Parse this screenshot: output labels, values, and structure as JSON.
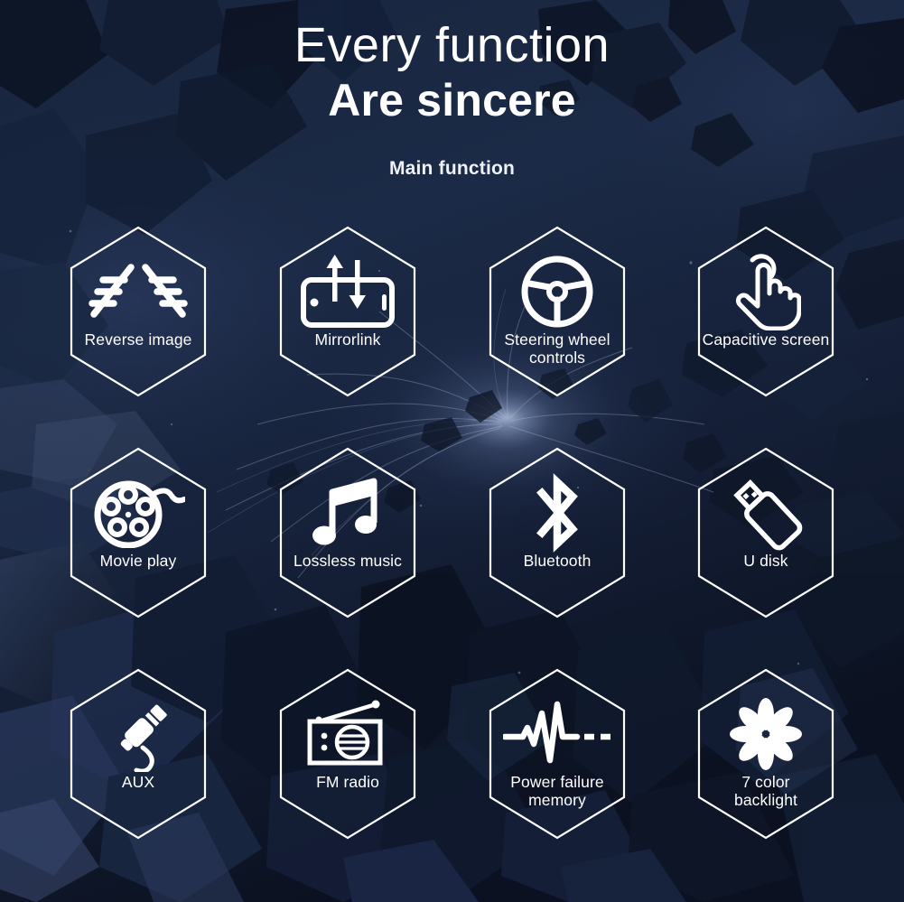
{
  "header": {
    "title_line1": "Every function",
    "title_line2": "Are sincere",
    "subtitle": "Main function"
  },
  "theme": {
    "background_dark": "#0d1627",
    "background_navy": "#1c2b47",
    "hex_stroke": "#ffffff",
    "text_color": "#ffffff",
    "glow_color": "#8fa6d8"
  },
  "features": [
    {
      "id": "reverse-image",
      "label": "Reverse image",
      "icon": "parking-guide-lines-icon",
      "row": 0,
      "col": 0
    },
    {
      "id": "mirrorlink",
      "label": "Mirrorlink",
      "icon": "phone-sync-arrows-icon",
      "row": 0,
      "col": 1
    },
    {
      "id": "steering-wheel",
      "label": "Steering wheel\ncontrols",
      "icon": "steering-wheel-icon",
      "row": 0,
      "col": 2
    },
    {
      "id": "capacitive-screen",
      "label": "Capacitive screen",
      "icon": "touch-hand-icon",
      "row": 0,
      "col": 3
    },
    {
      "id": "movie-play",
      "label": "Movie play",
      "icon": "film-reel-icon",
      "row": 1,
      "col": 0
    },
    {
      "id": "lossless-music",
      "label": "Lossless music",
      "icon": "music-note-icon",
      "row": 1,
      "col": 1
    },
    {
      "id": "bluetooth",
      "label": "Bluetooth",
      "icon": "bluetooth-icon",
      "row": 1,
      "col": 2
    },
    {
      "id": "u-disk",
      "label": "U disk",
      "icon": "usb-drive-icon",
      "row": 1,
      "col": 3
    },
    {
      "id": "aux",
      "label": "AUX",
      "icon": "audio-jack-icon",
      "row": 2,
      "col": 0
    },
    {
      "id": "fm-radio",
      "label": "FM radio",
      "icon": "radio-icon",
      "row": 2,
      "col": 1
    },
    {
      "id": "power-failure",
      "label": "Power failure\nmemory",
      "icon": "pulse-wave-icon",
      "row": 2,
      "col": 2
    },
    {
      "id": "backlight",
      "label": "7 color\nbacklight",
      "icon": "flower-petals-icon",
      "row": 2,
      "col": 3
    }
  ]
}
